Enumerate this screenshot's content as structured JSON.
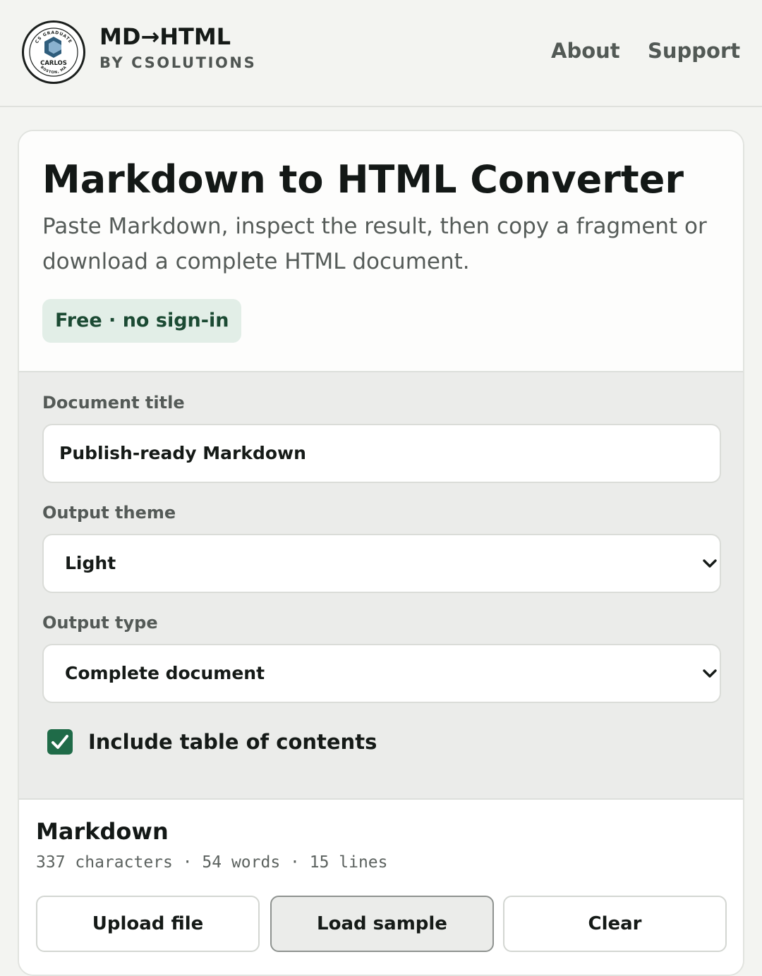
{
  "header": {
    "logo": {
      "icon": "graduate-logo-icon",
      "top_text": "CS GRADUATE",
      "name": "CARLOS",
      "bottom_text": "BOSTON, MA"
    },
    "brand_title": "MD→HTML",
    "brand_subtitle": "BY CSOLUTIONS",
    "nav": {
      "about": "About",
      "support": "Support"
    }
  },
  "hero": {
    "title": "Markdown to HTML Converter",
    "description": "Paste Markdown, inspect the result, then copy a fragment or download a complete HTML document.",
    "badge": "Free · no sign-in"
  },
  "options": {
    "document_title": {
      "label": "Document title",
      "value": "Publish-ready Markdown"
    },
    "output_theme": {
      "label": "Output theme",
      "selected": "Light",
      "icon": "chevron-down-icon"
    },
    "output_type": {
      "label": "Output type",
      "selected": "Complete document",
      "icon": "chevron-down-icon"
    },
    "toc": {
      "label": "Include table of contents",
      "checked": true
    }
  },
  "markdown": {
    "heading": "Markdown",
    "stats": "337 characters · 54 words · 15 lines",
    "buttons": {
      "upload": "Upload file",
      "sample": "Load sample",
      "clear": "Clear"
    }
  },
  "colors": {
    "accent": "#1f6b48",
    "badge_bg": "#e2eee7",
    "badge_text": "#1b4a33",
    "page_bg": "#f3f4f1",
    "panel_bg": "#ebecea"
  }
}
